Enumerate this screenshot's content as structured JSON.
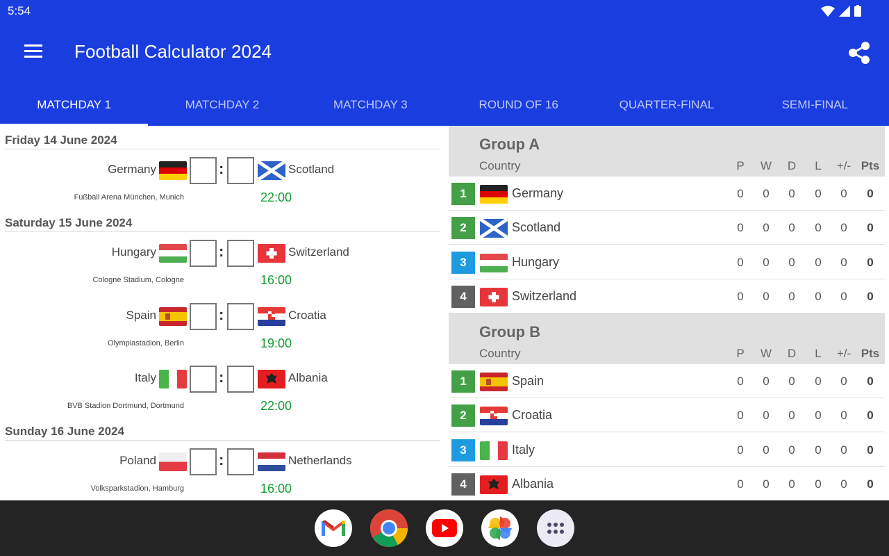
{
  "status_bar": {
    "time": "5:54"
  },
  "app_bar": {
    "title": "Football Calculator 2024"
  },
  "tabs": [
    {
      "label": "MATCHDAY 1",
      "active": true
    },
    {
      "label": "MATCHDAY 2",
      "active": false
    },
    {
      "label": "MATCHDAY 3",
      "active": false
    },
    {
      "label": "ROUND OF 16",
      "active": false
    },
    {
      "label": "QUARTER-FINAL",
      "active": false
    },
    {
      "label": "SEMI-FINAL",
      "active": false
    }
  ],
  "days": [
    {
      "label": "Friday 14 June 2024"
    },
    {
      "label": "Saturday 15 June 2024"
    },
    {
      "label": "Sunday 16 June 2024"
    }
  ],
  "matches": [
    {
      "home": "Germany",
      "away": "Scotland",
      "venue": "Fußball Arena München, Munich",
      "time": "22:00",
      "home_flag": "germany",
      "away_flag": "scotland"
    },
    {
      "home": "Hungary",
      "away": "Switzerland",
      "venue": "Cologne Stadium, Cologne",
      "time": "16:00",
      "home_flag": "hungary",
      "away_flag": "switzerland"
    },
    {
      "home": "Spain",
      "away": "Croatia",
      "venue": "Olympiastadion, Berlin",
      "time": "19:00",
      "home_flag": "spain",
      "away_flag": "croatia"
    },
    {
      "home": "Italy",
      "away": "Albania",
      "venue": "BVB Stadion Dortmund, Dortmund",
      "time": "22:00",
      "home_flag": "italy",
      "away_flag": "albania"
    },
    {
      "home": "Poland",
      "away": "Netherlands",
      "venue": "Volksparkstadion, Hamburg",
      "time": "16:00",
      "home_flag": "poland",
      "away_flag": "netherlands"
    }
  ],
  "table_columns": {
    "country": "Country",
    "p": "P",
    "w": "W",
    "d": "D",
    "l": "L",
    "gd": "+/-",
    "pts": "Pts"
  },
  "groups": [
    {
      "name": "Group A",
      "rows": [
        {
          "rank": "1",
          "team": "Germany",
          "flag": "germany",
          "p": "0",
          "w": "0",
          "d": "0",
          "l": "0",
          "gd": "0",
          "pts": "0"
        },
        {
          "rank": "2",
          "team": "Scotland",
          "flag": "scotland",
          "p": "0",
          "w": "0",
          "d": "0",
          "l": "0",
          "gd": "0",
          "pts": "0"
        },
        {
          "rank": "3",
          "team": "Hungary",
          "flag": "hungary",
          "p": "0",
          "w": "0",
          "d": "0",
          "l": "0",
          "gd": "0",
          "pts": "0"
        },
        {
          "rank": "4",
          "team": "Switzerland",
          "flag": "switzerland",
          "p": "0",
          "w": "0",
          "d": "0",
          "l": "0",
          "gd": "0",
          "pts": "0"
        }
      ]
    },
    {
      "name": "Group B",
      "rows": [
        {
          "rank": "1",
          "team": "Spain",
          "flag": "spain",
          "p": "0",
          "w": "0",
          "d": "0",
          "l": "0",
          "gd": "0",
          "pts": "0"
        },
        {
          "rank": "2",
          "team": "Croatia",
          "flag": "croatia",
          "p": "0",
          "w": "0",
          "d": "0",
          "l": "0",
          "gd": "0",
          "pts": "0"
        },
        {
          "rank": "3",
          "team": "Italy",
          "flag": "italy",
          "p": "0",
          "w": "0",
          "d": "0",
          "l": "0",
          "gd": "0",
          "pts": "0"
        },
        {
          "rank": "4",
          "team": "Albania",
          "flag": "albania",
          "p": "0",
          "w": "0",
          "d": "0",
          "l": "0",
          "gd": "0",
          "pts": "0"
        }
      ]
    }
  ],
  "rank_colors": [
    "#43a047",
    "#43a047",
    "#1e9be0",
    "#616161"
  ],
  "colors": {
    "app_bar": "#1a3ddf",
    "time_green": "#159c33",
    "dock": "#242424"
  },
  "dock_apps": [
    {
      "name": "gmail-icon"
    },
    {
      "name": "chrome-icon"
    },
    {
      "name": "youtube-icon"
    },
    {
      "name": "photos-icon"
    },
    {
      "name": "app-drawer-icon"
    }
  ]
}
